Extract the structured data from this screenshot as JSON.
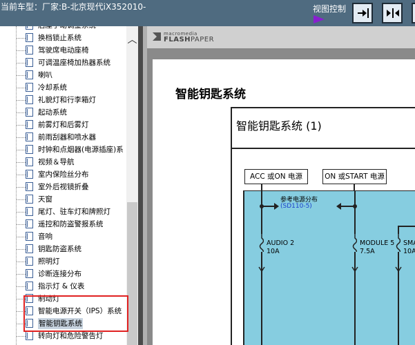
{
  "topbar": {
    "model_label": "当前车型：厂家:B-北京现代iX352010-",
    "view_control_label": "视图控制",
    "buttons": [
      {
        "name": "view-fit-right",
        "icon": "arrow-right-bar-icon"
      },
      {
        "name": "view-fit-width",
        "icon": "arrows-split-icon"
      },
      {
        "name": "view-extra",
        "icon": "arrow-extra-icon"
      }
    ]
  },
  "tree": {
    "partial_top_label": "后座手动调整系统",
    "items": [
      {
        "label": "换档锁止系统"
      },
      {
        "label": "驾驶席电动座椅"
      },
      {
        "label": "可调温座椅加热器系统"
      },
      {
        "label": "喇叭"
      },
      {
        "label": "冷却系统"
      },
      {
        "label": "礼貌灯和行李箱灯"
      },
      {
        "label": "起动系统"
      },
      {
        "label": "前雾灯和后雾灯"
      },
      {
        "label": "前雨刮器和喷水器"
      },
      {
        "label": "时钟和点烟器(电源插座)系"
      },
      {
        "label": "视频＆导航"
      },
      {
        "label": "室内保险丝分布"
      },
      {
        "label": "室外后视镜折叠"
      },
      {
        "label": "天窗"
      },
      {
        "label": "尾灯、驻车灯和牌照灯"
      },
      {
        "label": "遥控和防盗警报系统"
      },
      {
        "label": "音响"
      },
      {
        "label": "钥匙防盗系统"
      },
      {
        "label": "照明灯"
      },
      {
        "label": "诊断连接分布"
      },
      {
        "label": "指示灯 & 仪表"
      },
      {
        "label": "制动灯"
      },
      {
        "label": "智能电源开关（IPS）系统"
      },
      {
        "label": "智能钥匙系统",
        "selected": true
      },
      {
        "label": "转向灯和危险警告灯"
      }
    ]
  },
  "viewer": {
    "brand_small": "macromedia",
    "brand_main": "FLASH",
    "brand_suffix": "PAPER",
    "doc_title": "智能钥匙系统",
    "diagram_title": "智能钥匙系统 (1)",
    "power_acc": "ACC 或ON 电源",
    "power_on": "ON 或START 电源",
    "ref_text": "参考电源分布",
    "ref_link": "(SD110-5)",
    "fuses": [
      {
        "name": "AUDIO 2",
        "rating": "10A"
      },
      {
        "name": "MODULE 5",
        "rating": "7.5A"
      },
      {
        "name": "SMA KEY",
        "rating": "10A"
      }
    ]
  }
}
